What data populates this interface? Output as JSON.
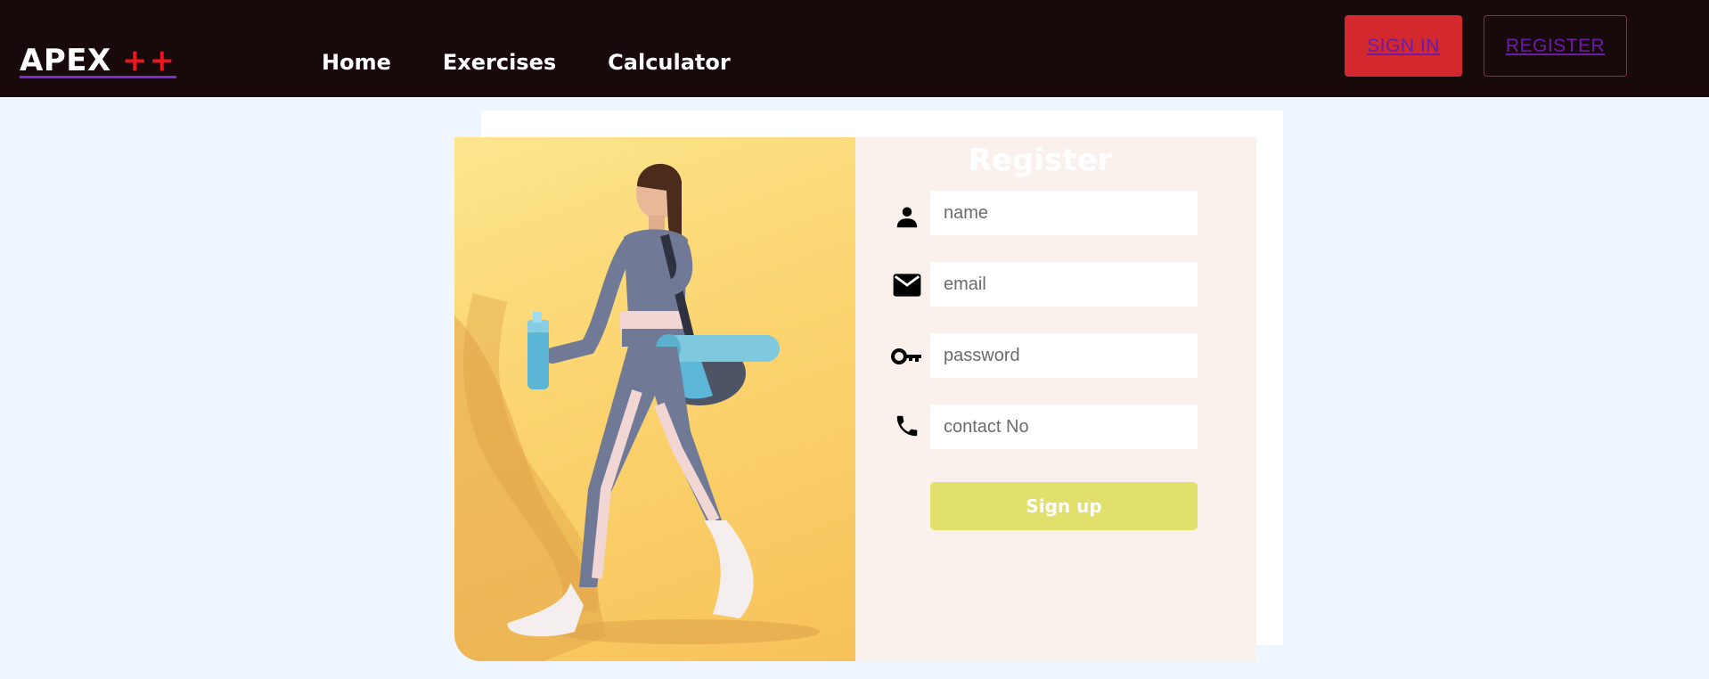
{
  "navbar": {
    "logo_text": "APEX",
    "logo_plus": "++",
    "links": [
      "Home",
      "Exercises",
      "Calculator"
    ],
    "signin_label": "SIGN IN",
    "register_label": "REGISTER"
  },
  "form": {
    "title": "Register",
    "fields": [
      {
        "icon": "person-icon",
        "placeholder": "name"
      },
      {
        "icon": "mail-icon",
        "placeholder": "email"
      },
      {
        "icon": "key-icon",
        "placeholder": "password"
      },
      {
        "icon": "phone-icon",
        "placeholder": "contact No"
      }
    ],
    "submit_label": "Sign up"
  },
  "image": {
    "icon": "fitness-woman-photo"
  },
  "colors": {
    "navbar_bg": "#18090b",
    "accent_red": "#d3282e",
    "button_yellow": "#e1e06c",
    "page_bg": "#eff6ff",
    "form_bg": "#faf1ec",
    "image_bg": "#fbd46f"
  }
}
